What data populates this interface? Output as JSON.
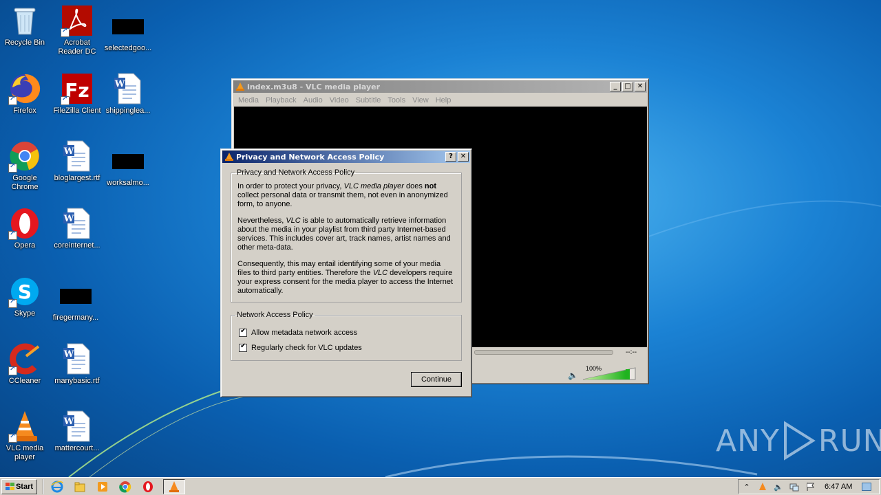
{
  "desktop_icons": [
    {
      "label": "Recycle Bin",
      "icon": "recycle-bin-icon"
    },
    {
      "label": "Acrobat Reader DC",
      "icon": "acrobat-icon"
    },
    {
      "label": "selectedgoo...",
      "icon": "redacted-file-icon"
    },
    {
      "label": "Firefox",
      "icon": "firefox-icon"
    },
    {
      "label": "FileZilla Client",
      "icon": "filezilla-icon"
    },
    {
      "label": "shippinglea...",
      "icon": "word-doc-icon"
    },
    {
      "label": "Google Chrome",
      "icon": "chrome-icon"
    },
    {
      "label": "bloglargest.rtf",
      "icon": "word-doc-icon"
    },
    {
      "label": "worksalmo...",
      "icon": "redacted-file-icon"
    },
    {
      "label": "Opera",
      "icon": "opera-icon"
    },
    {
      "label": "coreinternet...",
      "icon": "word-doc-icon"
    },
    {
      "label": "Skype",
      "icon": "skype-icon"
    },
    {
      "label": "firegermany...",
      "icon": "redacted-file-icon"
    },
    {
      "label": "CCleaner",
      "icon": "ccleaner-icon"
    },
    {
      "label": "manybasic.rtf",
      "icon": "word-doc-icon"
    },
    {
      "label": "VLC media player",
      "icon": "vlc-icon"
    },
    {
      "label": "mattercourt...",
      "icon": "word-doc-icon"
    }
  ],
  "vlc": {
    "title": "index.m3u8 - VLC media player",
    "menu": [
      "Media",
      "Playback",
      "Audio",
      "Video",
      "Subtitle",
      "Tools",
      "View",
      "Help"
    ],
    "time": "--:--",
    "volume": "100%",
    "volume_level": 1.0
  },
  "dialog": {
    "title": "Privacy and Network Access Policy",
    "help_btn": "?",
    "close_btn": "✕",
    "group1_legend": "Privacy and Network Access Policy",
    "p1_a": "In order to protect your privacy, ",
    "p1_em": "VLC media player",
    "p1_b": " does ",
    "p1_strong": "not",
    "p1_c": " collect personal data or transmit them, not even in anonymized form, to anyone.",
    "p2_a": "Nevertheless, ",
    "p2_em": "VLC",
    "p2_b": " is able to automatically retrieve information about the media in your playlist from third party Internet-based services. This includes cover art, track names, artist names and other meta-data.",
    "p3_a": "Consequently, this may entail identifying some of your media files to third party entities. Therefore the ",
    "p3_em": "VLC",
    "p3_b": " developers require your express consent for the media player to access the Internet automatically.",
    "group2_legend": "Network Access Policy",
    "check1": "Allow metadata network access",
    "check2": "Regularly check for VLC updates",
    "continue": "Continue"
  },
  "taskbar": {
    "start": "Start",
    "clock": "6:47 AM"
  },
  "watermark": {
    "left": "ANY",
    "right": "RUN"
  }
}
